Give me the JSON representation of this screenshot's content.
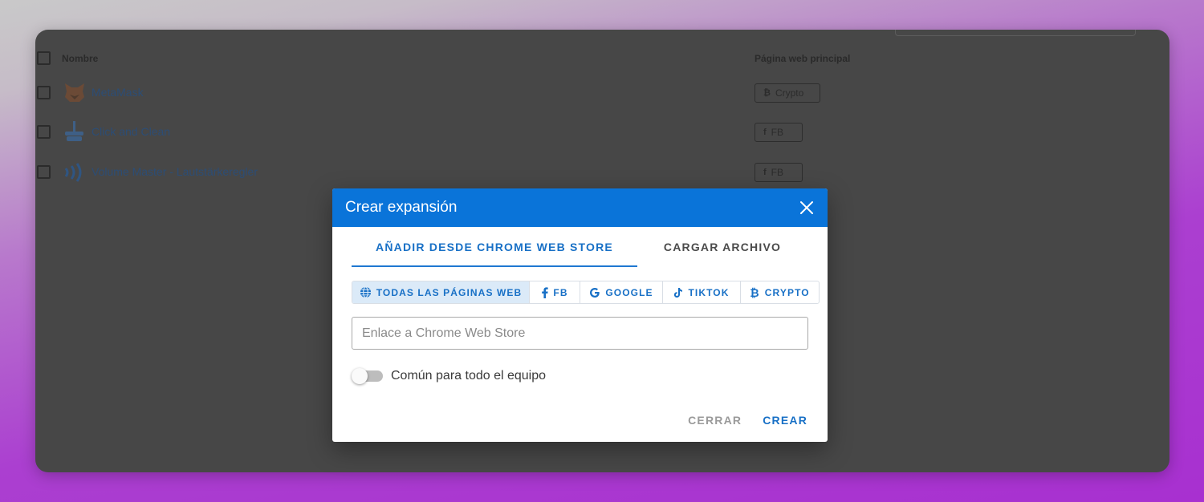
{
  "background_list": {
    "headers": {
      "name": "Nombre",
      "homepage": "Página web principal"
    },
    "rows": [
      {
        "name": "MetaMask",
        "icon": "fox-icon",
        "tag": "Crypto",
        "tag_icon": "bitcoin-icon"
      },
      {
        "name": "Click and Clean",
        "icon": "broom-icon",
        "tag": "FB",
        "tag_icon": "facebook-icon"
      },
      {
        "name": "Volume Master - Lautstärkeregler",
        "icon": "sound-waves-icon",
        "tag": "FB",
        "tag_icon": "facebook-icon"
      }
    ]
  },
  "dialog": {
    "title": "Crear expansión",
    "tabs": [
      {
        "label": "AÑADIR DESDE CHROME WEB STORE",
        "active": true
      },
      {
        "label": "CARGAR ARCHIVO",
        "active": false
      }
    ],
    "filters": [
      {
        "label": "TODAS LAS PÁGINAS WEB",
        "icon": "globe-icon",
        "active": true
      },
      {
        "label": "FB",
        "icon": "facebook-icon",
        "active": false
      },
      {
        "label": "GOOGLE",
        "icon": "google-icon",
        "active": false
      },
      {
        "label": "TIKTOK",
        "icon": "tiktok-icon",
        "active": false
      },
      {
        "label": "CRYPTO",
        "icon": "bitcoin-icon",
        "active": false
      }
    ],
    "link_input": {
      "placeholder": "Enlace a Chrome Web Store",
      "value": ""
    },
    "toggle": {
      "label": "Común para todo el equipo",
      "on": false
    },
    "buttons": {
      "close": "CERRAR",
      "create": "CREAR"
    }
  },
  "colors": {
    "primary": "#0a74d9",
    "accent_text": "#1870c6",
    "overlay": "#474747",
    "page_gradient_end": "#a830d0"
  }
}
